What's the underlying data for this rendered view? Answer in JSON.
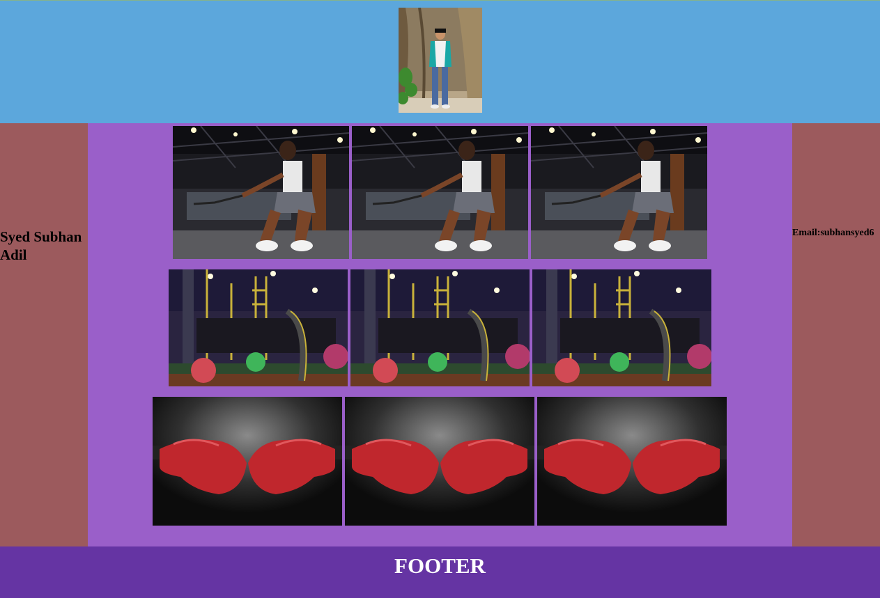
{
  "header": {
    "profile_image": "profile-photo-man-standing-by-tree"
  },
  "left_sidebar": {
    "name": "Syed Subhan Adil"
  },
  "right_sidebar": {
    "email": "Email:subhansyed6"
  },
  "gallery": {
    "rows": [
      {
        "subject": "woman-battle-ropes-gym",
        "count": 3
      },
      {
        "subject": "gym-interior-equipment",
        "count": 3
      },
      {
        "subject": "red-boxing-gloves",
        "count": 3
      }
    ]
  },
  "footer": {
    "title": "FOOTER"
  },
  "colors": {
    "header_bg": "#5ca7dc",
    "sidebar_bg": "#9c5a5d",
    "main_bg": "#9a5fc9",
    "footer_bg": "#6534a3"
  }
}
